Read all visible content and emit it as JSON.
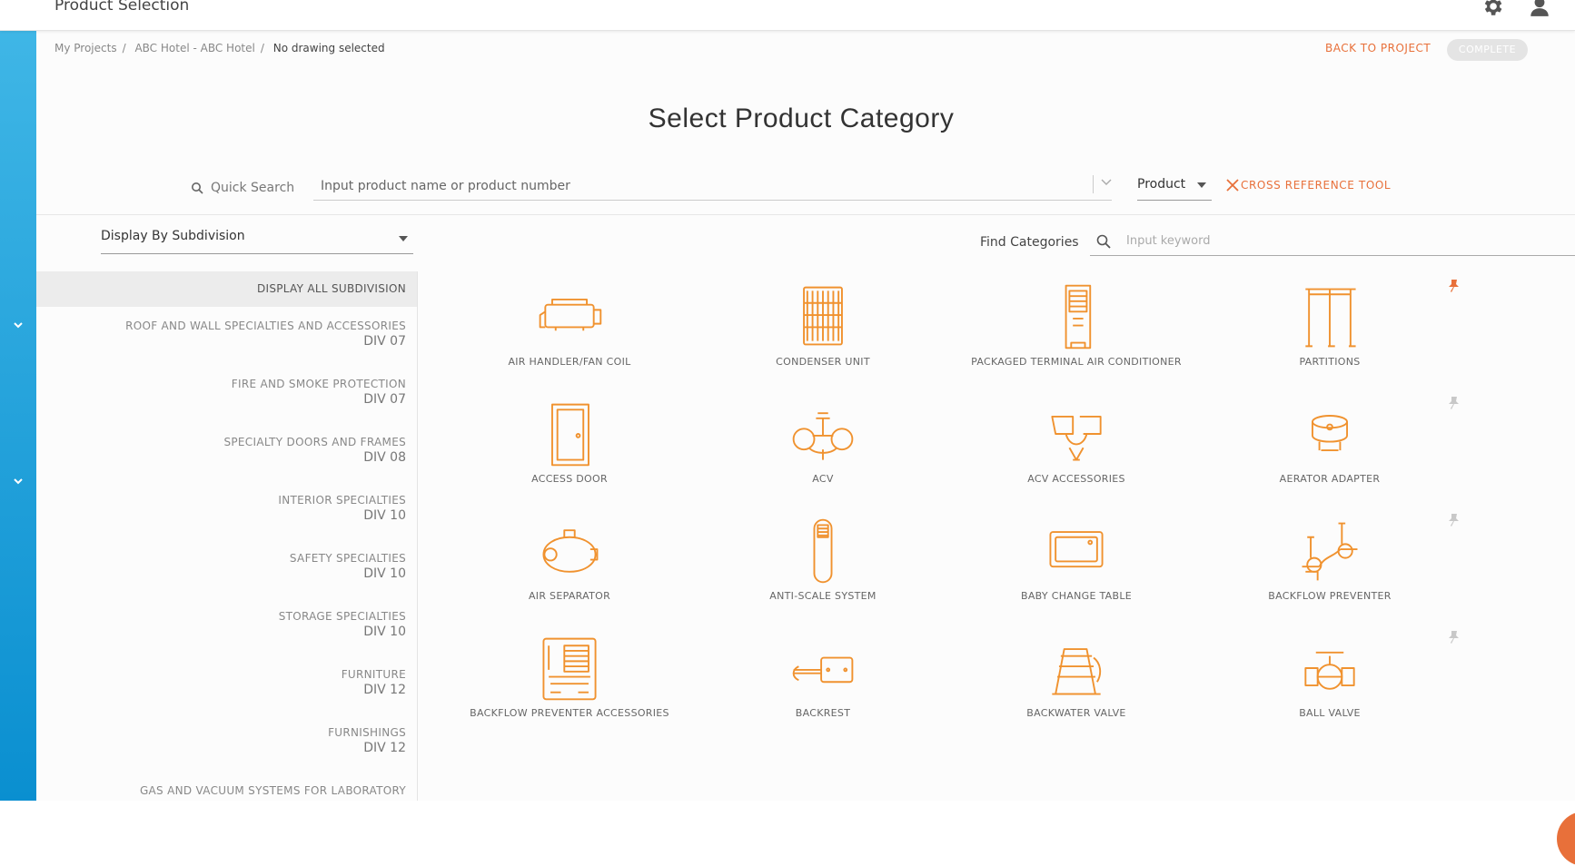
{
  "topbar": {
    "title": "Product Selection",
    "settings_icon": "gear-icon",
    "user_icon": "user-icon"
  },
  "breadcrumb": {
    "items": [
      "My Projects",
      "ABC Hotel - ABC Hotel"
    ],
    "current": "No drawing selected"
  },
  "actions": {
    "back_label": "BACK TO PROJECT",
    "complete_label": "COMPLETE"
  },
  "page": {
    "title": "Select Product Category"
  },
  "search": {
    "label": "Quick Search",
    "placeholder": "Input product name or product number",
    "type_select": "Product",
    "cross_ref_label": "CROSS REFERENCE TOOL"
  },
  "filters": {
    "display_by": "Display By Subdivision",
    "find_label": "Find Categories",
    "find_placeholder": "Input keyword"
  },
  "sidebar": {
    "all_label": "DISPLAY ALL SUBDIVISION",
    "items": [
      {
        "name": "ROOF AND WALL SPECIALTIES AND ACCESSORIES",
        "div": "DIV 07"
      },
      {
        "name": "FIRE AND SMOKE PROTECTION",
        "div": "DIV 07"
      },
      {
        "name": "SPECIALTY DOORS AND FRAMES",
        "div": "DIV 08"
      },
      {
        "name": "INTERIOR SPECIALTIES",
        "div": "DIV 10"
      },
      {
        "name": "SAFETY SPECIALTIES",
        "div": "DIV 10"
      },
      {
        "name": "STORAGE SPECIALTIES",
        "div": "DIV 10"
      },
      {
        "name": "FURNITURE",
        "div": "DIV 12"
      },
      {
        "name": "FURNISHINGS",
        "div": "DIV 12"
      },
      {
        "name": "GAS AND VACUUM SYSTEMS FOR LABORATORY",
        "div": ""
      }
    ]
  },
  "categories": [
    {
      "label": "AIR HANDLER/FAN COIL",
      "pinned": true,
      "icon": "air-handler-icon"
    },
    {
      "label": "CONDENSER UNIT",
      "pinned": true,
      "icon": "condenser-icon"
    },
    {
      "label": "PACKAGED TERMINAL AIR CONDITIONER",
      "pinned": true,
      "icon": "ptac-icon"
    },
    {
      "label": "PARTITIONS",
      "pinned": true,
      "icon": "partitions-icon"
    },
    {
      "label": "ACCESS DOOR",
      "pinned": false,
      "icon": "access-door-icon"
    },
    {
      "label": "ACV",
      "pinned": false,
      "icon": "acv-icon"
    },
    {
      "label": "ACV ACCESSORIES",
      "pinned": false,
      "icon": "acv-accessories-icon"
    },
    {
      "label": "AERATOR ADAPTER",
      "pinned": false,
      "icon": "aerator-adapter-icon"
    },
    {
      "label": "AIR SEPARATOR",
      "pinned": false,
      "icon": "air-separator-icon"
    },
    {
      "label": "ANTI-SCALE SYSTEM",
      "pinned": false,
      "icon": "anti-scale-icon"
    },
    {
      "label": "BABY CHANGE TABLE",
      "pinned": false,
      "icon": "baby-change-table-icon"
    },
    {
      "label": "BACKFLOW PREVENTER",
      "pinned": false,
      "icon": "backflow-preventer-icon"
    },
    {
      "label": "BACKFLOW PREVENTER ACCESSORIES",
      "pinned": false,
      "icon": "backflow-accessories-icon"
    },
    {
      "label": "BACKREST",
      "pinned": false,
      "icon": "backrest-icon"
    },
    {
      "label": "BACKWATER VALVE",
      "pinned": false,
      "icon": "backwater-valve-icon"
    },
    {
      "label": "BALL VALVE",
      "pinned": false,
      "icon": "ball-valve-icon"
    }
  ],
  "colors": {
    "accent": "#e8703a",
    "pin_active": "#e8703a",
    "pin_inactive": "#c8c8c8",
    "rail": "#1a9ad8",
    "icon_stroke": "#f0922f"
  }
}
